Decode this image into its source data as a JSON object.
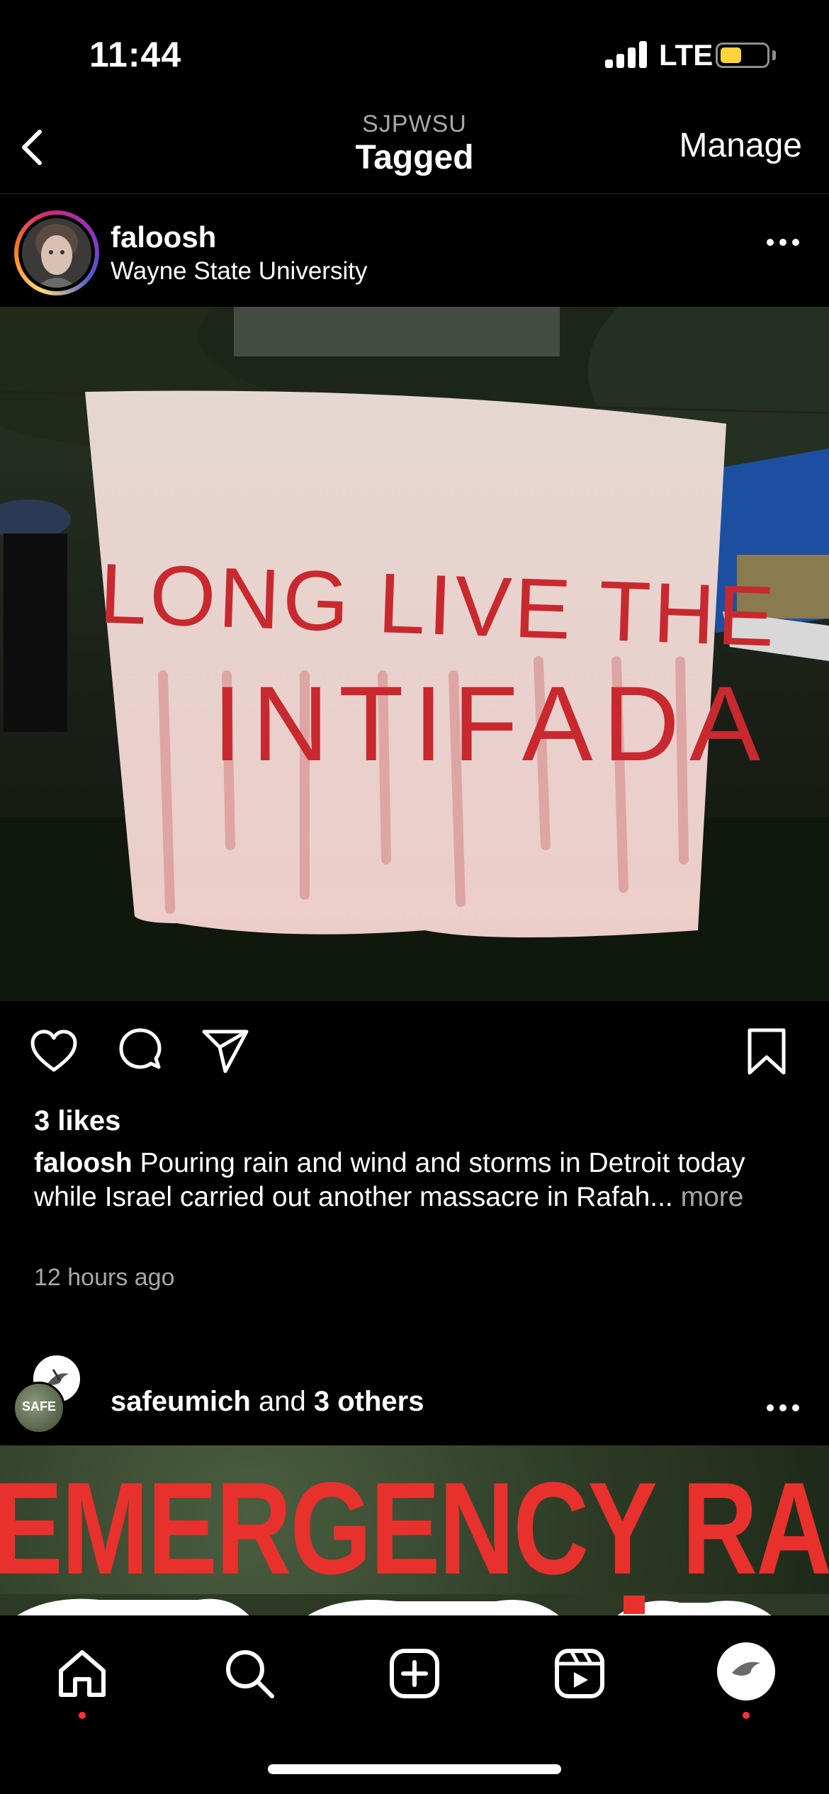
{
  "status_bar": {
    "time": "11:44",
    "network": "LTE",
    "battery_level": 0.45,
    "battery_color": "#ffd43b"
  },
  "header": {
    "subtitle": "SJPWSU",
    "title": "Tagged",
    "manage_label": "Manage",
    "back_icon": "chevron-left-icon"
  },
  "post1": {
    "username": "faloosh",
    "location": "Wayne State University",
    "more_icon": "ellipsis-icon",
    "banner_text": [
      "LONG LIVE THE",
      "INTIFADA"
    ],
    "likes": "3 likes",
    "caption_user": "faloosh",
    "caption_text": " Pouring rain and wind and storms in Detroit today while Israel carried out another massacre in Rafah...",
    "caption_more": " more",
    "time_ago": "12 hours ago",
    "actions": [
      "heart-icon",
      "comment-icon",
      "share-icon",
      "bookmark-icon"
    ]
  },
  "post2": {
    "avatar_text": "SAFE",
    "user": "safeumich",
    "joiner": " and ",
    "others": "3 others",
    "more_icon": "ellipsis-icon",
    "image_text": "EMERGENCY RALLY"
  },
  "tab_bar": {
    "tabs": [
      "home-icon",
      "search-icon",
      "create-icon",
      "reels-icon",
      "profile-icon"
    ],
    "notification_color": "#ff3040"
  }
}
